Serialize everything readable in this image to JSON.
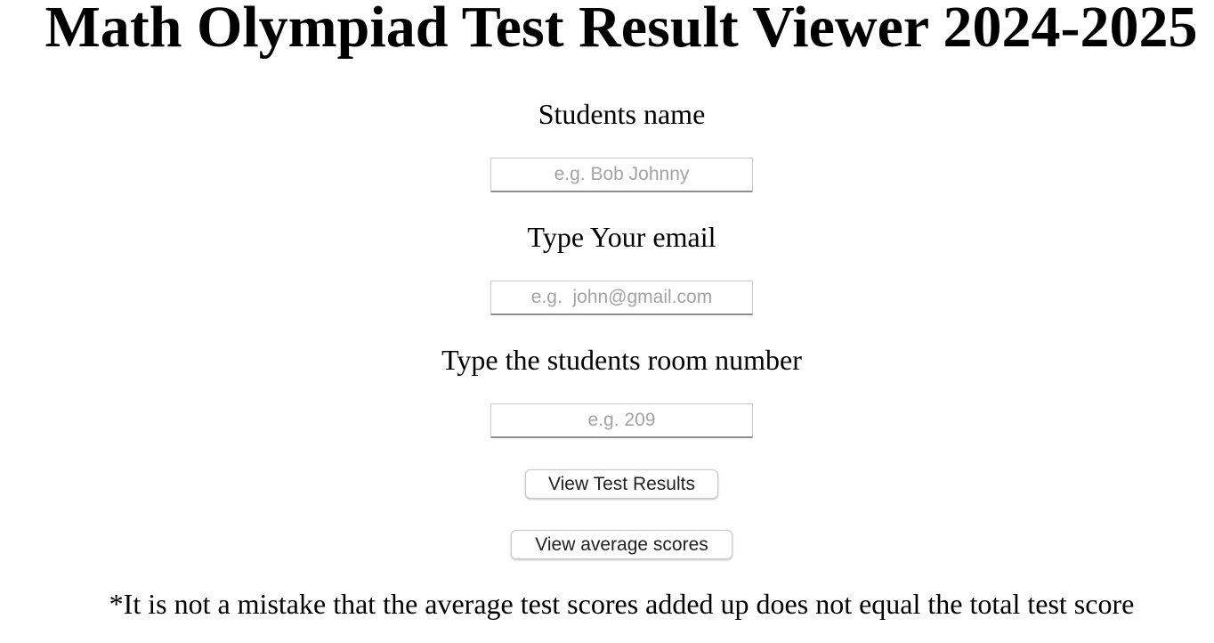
{
  "page": {
    "title": "Math Olympiad Test Result Viewer 2024-2025"
  },
  "form": {
    "student_name": {
      "label": "Students name",
      "value": "",
      "placeholder": "e.g. Bob Johnny"
    },
    "email": {
      "label": "Type Your email",
      "value": "",
      "placeholder": "e.g.  john@gmail.com"
    },
    "room_number": {
      "label": "Type the students room number",
      "value": "",
      "placeholder": "e.g. 209"
    }
  },
  "actions": {
    "view_results_label": "View Test Results",
    "view_average_label": "View average scores"
  },
  "footnote": "*It is not a mistake that the average test scores added up does not equal the total test score"
}
